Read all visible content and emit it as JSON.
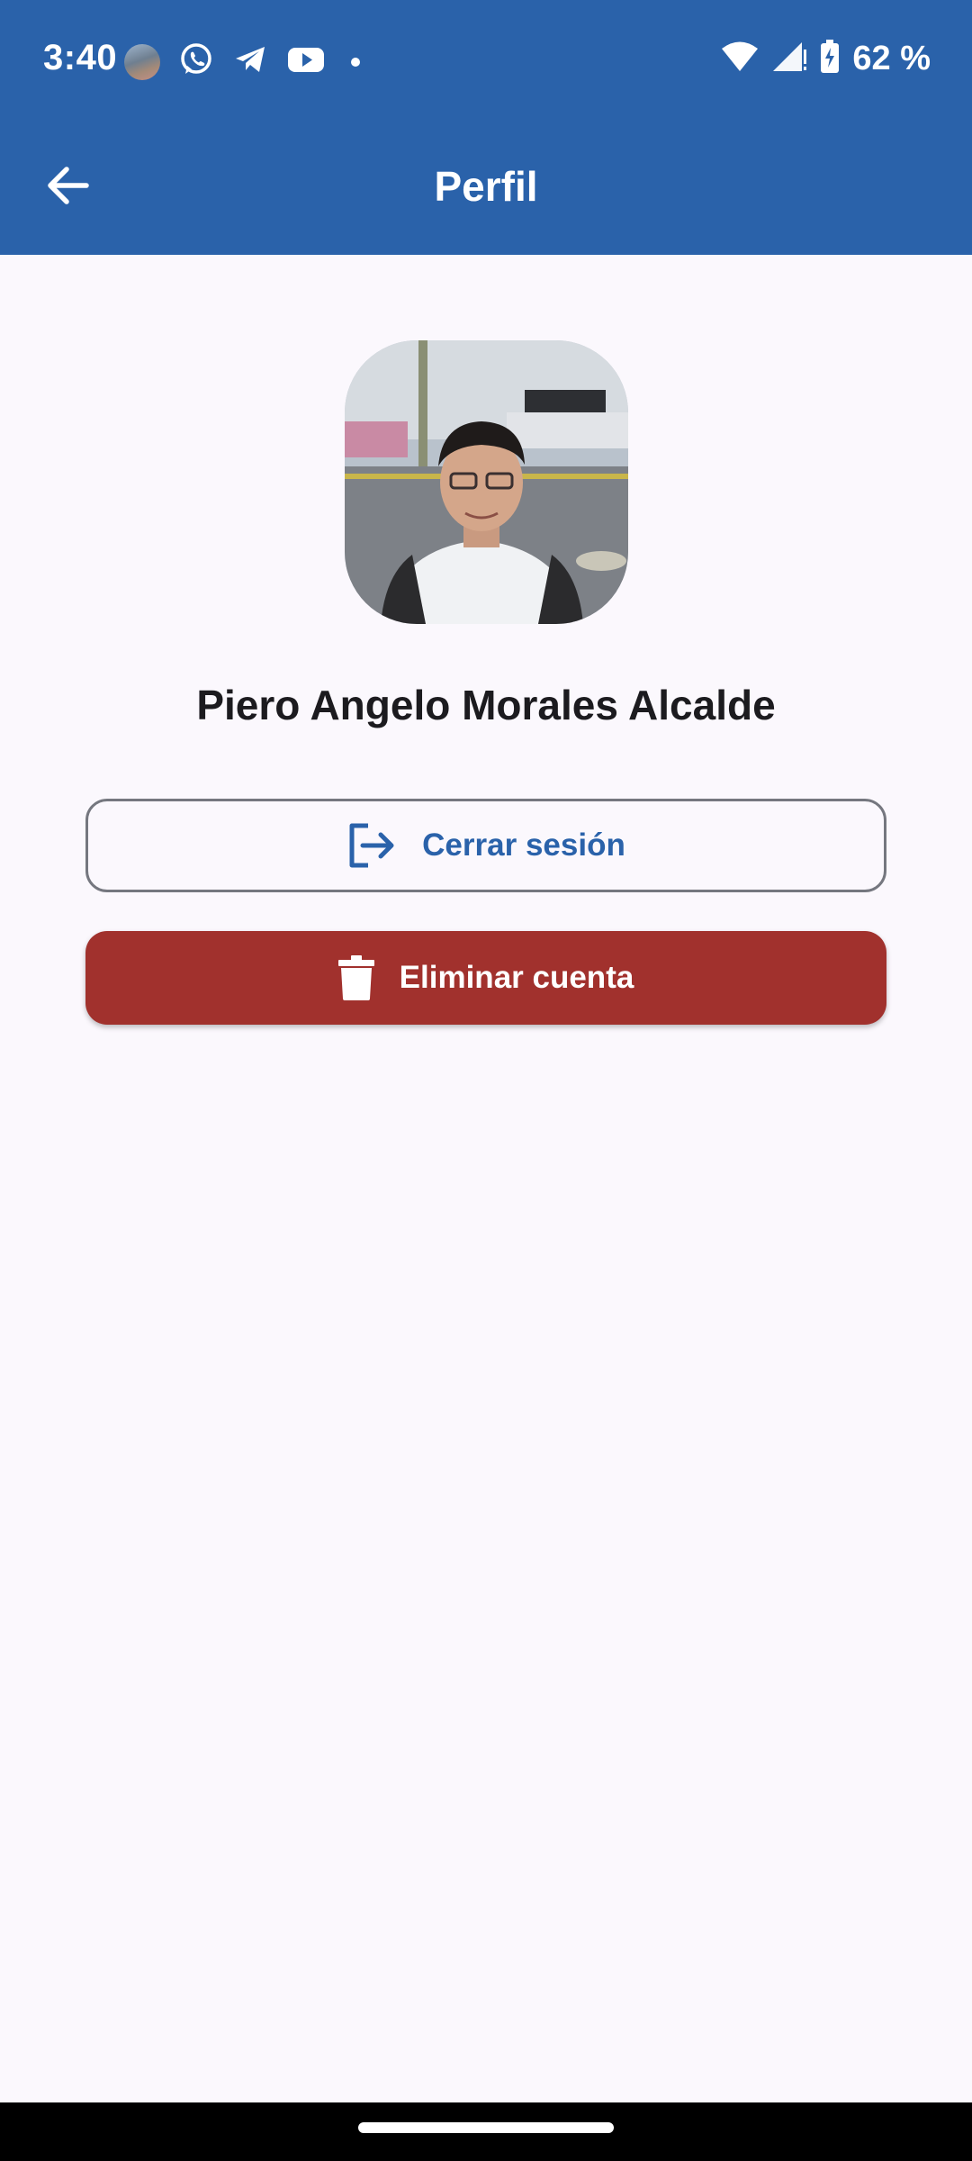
{
  "status_bar": {
    "time": "3:40",
    "battery_percent": "62 %",
    "left_icons": [
      "contact-avatar-icon",
      "whatsapp-icon",
      "telegram-icon",
      "youtube-icon",
      "notification-dot-icon"
    ],
    "right_icons": [
      "wifi-icon",
      "signal-icon",
      "battery-charging-icon"
    ]
  },
  "app_bar": {
    "title": "Perfil",
    "back_icon": "arrow-back-icon"
  },
  "profile": {
    "name": "Piero Angelo Morales Alcalde"
  },
  "actions": {
    "logout_label": "Cerrar sesión",
    "logout_icon": "logout-icon",
    "delete_label": "Eliminar cuenta",
    "delete_icon": "trash-icon"
  },
  "colors": {
    "primary": "#2a62aa",
    "danger": "#a1312d",
    "background": "#fbf8fd"
  }
}
